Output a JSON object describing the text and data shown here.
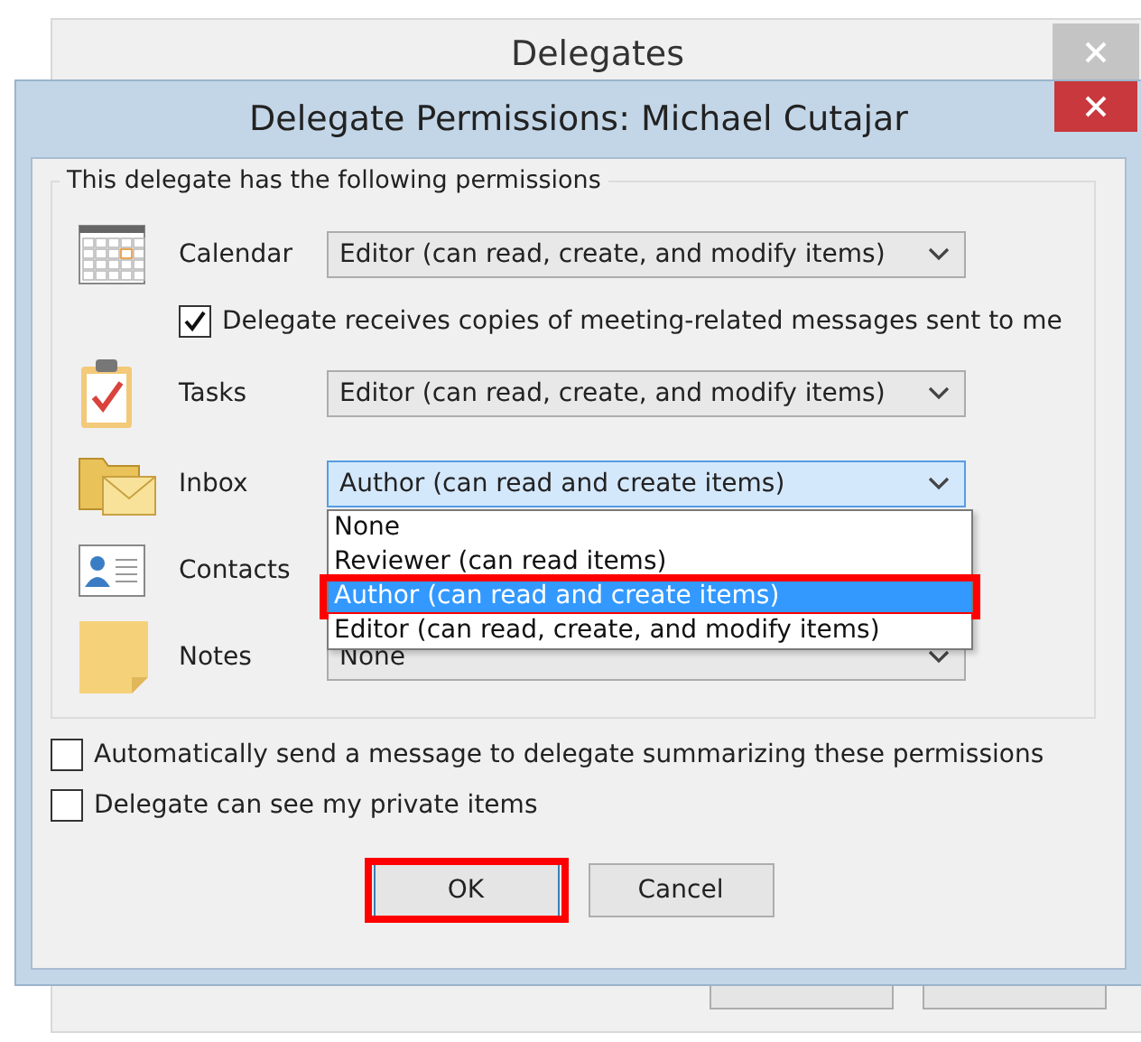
{
  "back_window": {
    "title": "Delegates"
  },
  "dialog": {
    "title": "Delegate Permissions: Michael Cutajar",
    "group_title": "This delegate has the following permissions",
    "folders": [
      {
        "kind": "calendar",
        "label": "Calendar",
        "value": "Editor (can read, create, and modify items)",
        "option": {
          "label": "Delegate receives copies of meeting-related messages sent to me",
          "checked": true
        }
      },
      {
        "kind": "tasks",
        "label": "Tasks",
        "value": "Editor (can read, create, and modify items)"
      },
      {
        "kind": "inbox",
        "label": "Inbox",
        "value": "Author (can read and create items)",
        "expanded": true,
        "options": [
          {
            "label": "None",
            "selected": false,
            "highlighted": false
          },
          {
            "label": "Reviewer (can read items)",
            "selected": false,
            "highlighted": false
          },
          {
            "label": "Author (can read and create items)",
            "selected": true,
            "highlighted": true
          },
          {
            "label": "Editor (can read, create, and modify items)",
            "selected": false,
            "highlighted": false
          }
        ]
      },
      {
        "kind": "contacts",
        "label": "Contacts"
      },
      {
        "kind": "notes",
        "label": "Notes",
        "value": "None"
      }
    ],
    "checkboxes": [
      {
        "label": "Automatically send a message to delegate summarizing these permissions",
        "checked": false
      },
      {
        "label": "Delegate can see my private items",
        "checked": false
      }
    ],
    "buttons": [
      {
        "label": "OK",
        "kind": "ok",
        "highlighted": true
      },
      {
        "label": "Cancel",
        "kind": "cancel",
        "highlighted": false
      }
    ]
  }
}
